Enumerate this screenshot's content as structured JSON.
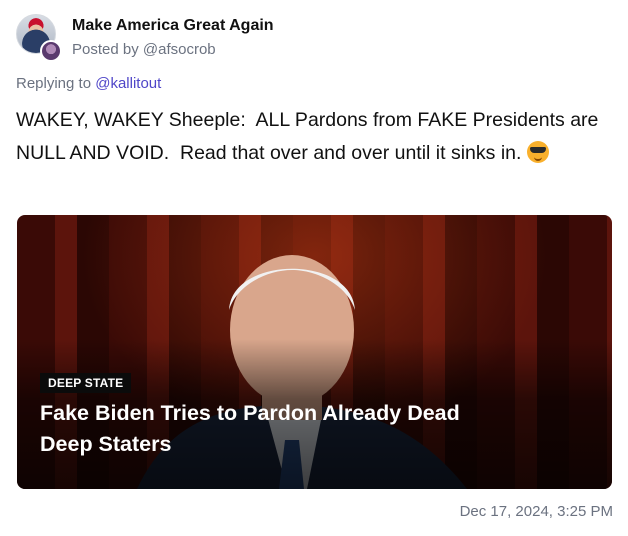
{
  "author": {
    "display_name": "Make America Great Again",
    "posted_by": "Posted by @afsocrob"
  },
  "reply": {
    "prefix": "Replying to ",
    "handle": "@kallitout"
  },
  "post": {
    "text": "WAKEY, WAKEY Sheeple:  ALL Pardons from FAKE Presidents are NULL AND VOID.  Read that over and over until it sinks in. ",
    "emoji": "sunglasses-emoji"
  },
  "link_card": {
    "category": "DEEP STATE",
    "headline": "Fake Biden Tries to Pardon Already Dead Deep Staters"
  },
  "timestamp": "Dec 17, 2024, 3:25 PM",
  "colors": {
    "link": "#4f46c8",
    "muted": "#6b7280",
    "card_background": "#3a0a06"
  }
}
